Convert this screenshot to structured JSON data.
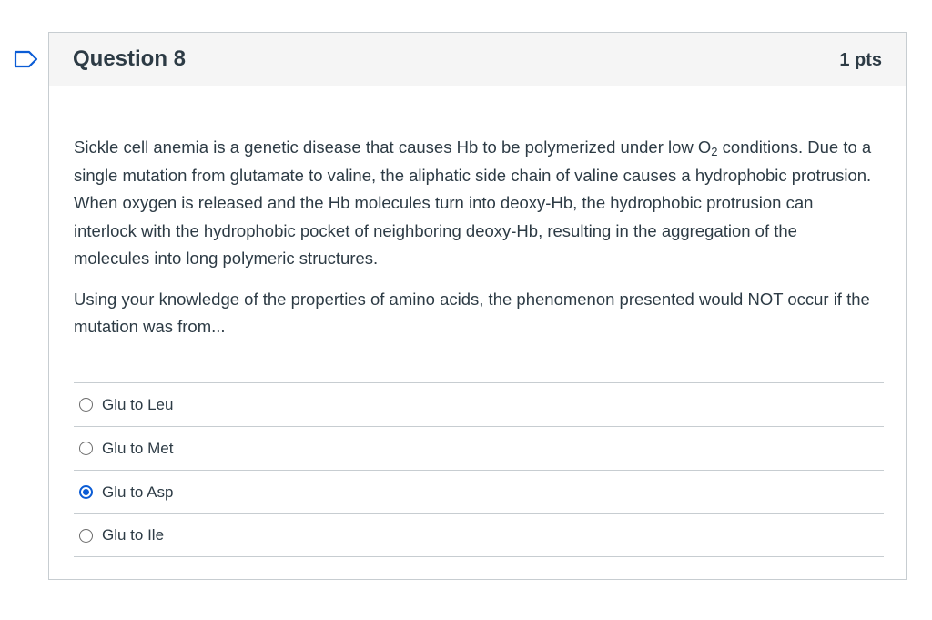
{
  "question": {
    "title": "Question 8",
    "points": "1 pts",
    "paragraph1_before_o2": "Sickle cell anemia is a genetic disease that causes Hb to be polymerized under low O",
    "o2_subscript": "2",
    "paragraph1_after_o2": " conditions. Due to a single mutation from glutamate to valine, the aliphatic side chain of valine causes a hydrophobic protrusion. When oxygen is released and the Hb molecules turn into deoxy-Hb, the hydrophobic protrusion can interlock with the hydrophobic pocket of neighboring deoxy-Hb, resulting in the aggregation of the molecules into long polymeric structures.",
    "paragraph2": "Using your knowledge of the properties of amino acids, the phenomenon presented would NOT occur if the mutation was from..."
  },
  "answers": [
    {
      "label": "Glu to Leu",
      "selected": false
    },
    {
      "label": "Glu to Met",
      "selected": false
    },
    {
      "label": "Glu to Asp",
      "selected": true
    },
    {
      "label": "Glu to Ile",
      "selected": false
    }
  ],
  "colors": {
    "accent": "#0b5cd5",
    "text": "#2d3b45",
    "border": "#c7cdd1",
    "header_bg": "#f5f5f5"
  },
  "icons": {
    "flag": "bookmark-flag-icon"
  }
}
